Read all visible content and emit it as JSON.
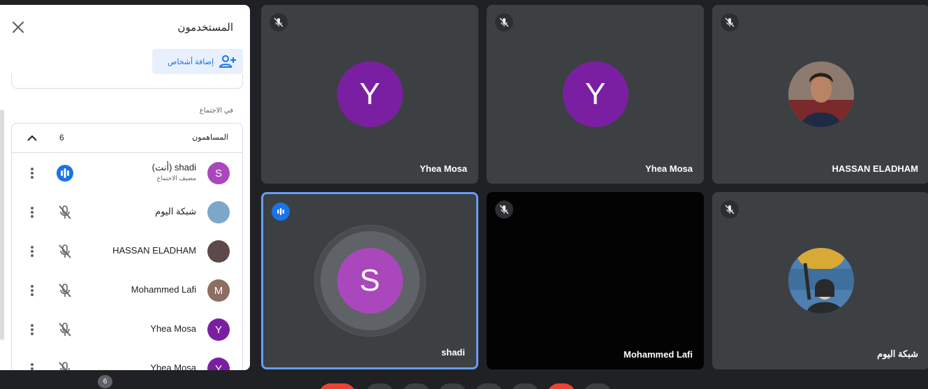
{
  "panel": {
    "title": "المستخدمون",
    "add_people_label": "إضافة أشخاص",
    "section_label": "في الاجتماع",
    "group_name": "المساهمون",
    "group_count": "6",
    "participants": [
      {
        "name": "shadi (أنت)",
        "role": "مضيف الاجتماع",
        "avatar_letter": "S",
        "avatar_color": "#ab47bc",
        "mic": "speaking"
      },
      {
        "name": "شبكة اليوم",
        "role": "",
        "avatar_letter": "",
        "avatar_color": "#7da7c9",
        "mic": "muted"
      },
      {
        "name": "HASSAN ELADHAM",
        "role": "",
        "avatar_letter": "",
        "avatar_color": "#5b4a47",
        "mic": "muted"
      },
      {
        "name": "Mohammed Lafi",
        "role": "",
        "avatar_letter": "M",
        "avatar_color": "#8d6e63",
        "mic": "muted"
      },
      {
        "name": "Yhea Mosa",
        "role": "",
        "avatar_letter": "Y",
        "avatar_color": "#7b1fa2",
        "mic": "muted"
      },
      {
        "name": "Yhea Mosa",
        "role": "",
        "avatar_letter": "Y",
        "avatar_color": "#7b1fa2",
        "mic": "muted"
      }
    ]
  },
  "tiles": [
    {
      "name": "Yhea Mosa",
      "avatar_letter": "Y",
      "avatar_color": "#7b1fa2"
    },
    {
      "name": "Yhea Mosa",
      "avatar_letter": "Y",
      "avatar_color": "#7b1fa2"
    },
    {
      "name": "HASSAN ELADHAM",
      "avatar_letter": "",
      "avatar_color": "#6b5550"
    },
    {
      "name": "shadi",
      "avatar_letter": "S",
      "avatar_color": "#ab47bc"
    },
    {
      "name": "Mohammed Lafi",
      "avatar_letter": "",
      "avatar_color": "#030304"
    },
    {
      "name": "شبكة اليوم",
      "avatar_letter": "",
      "avatar_color": "#5f8fb8"
    }
  ],
  "bottom_bar": {
    "participant_count": "6"
  }
}
